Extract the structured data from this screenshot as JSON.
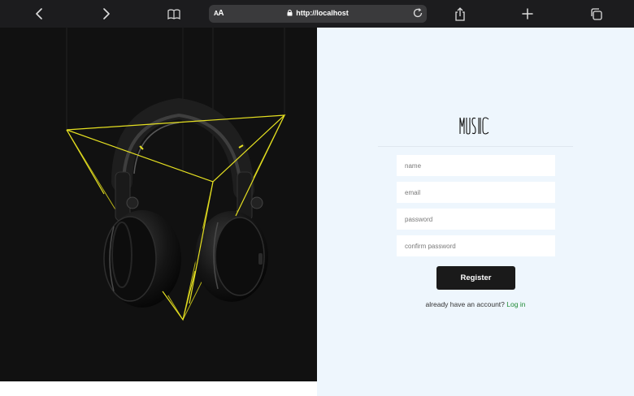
{
  "browser": {
    "url": "http://localhost",
    "reader_text_small": "A",
    "reader_text_large": "A",
    "icons": [
      "chevron-left-icon",
      "chevron-right-icon",
      "book-icon",
      "lock-icon",
      "reload-icon",
      "share-icon",
      "plus-icon",
      "tabs-icon"
    ]
  },
  "form": {
    "logo_text": "MUSIC",
    "name_placeholder": "name",
    "email_placeholder": "email",
    "password_placeholder": "password",
    "confirm_placeholder": "confirm password",
    "register_label": "Register",
    "signin_prompt": "already have an account?",
    "signin_link": "Log in"
  },
  "colors": {
    "toolbar": "#1c1c1e",
    "hero_bg": "#111111",
    "panel_bg": "#eef6fd",
    "accent_line": "#e5e021",
    "button_bg": "#1a1a1a",
    "link": "#1e8a34"
  }
}
